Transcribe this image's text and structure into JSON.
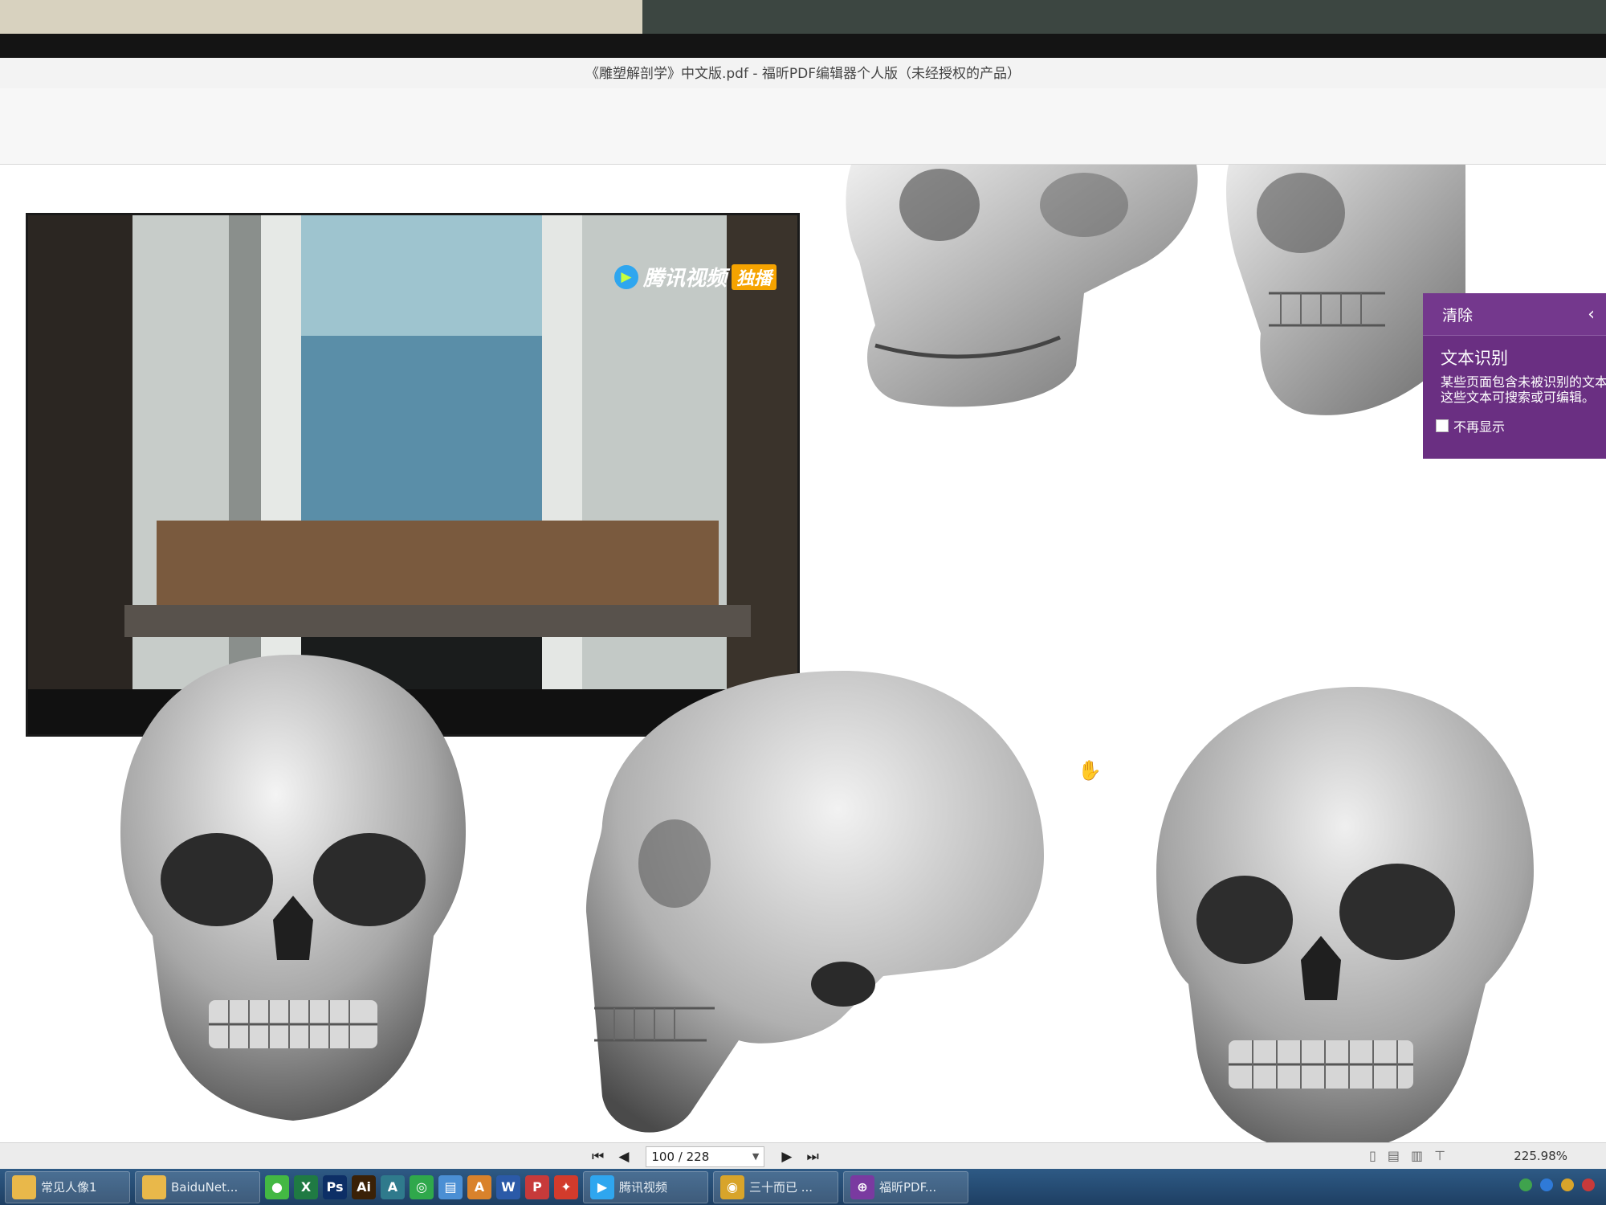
{
  "window": {
    "title": "《雕塑解剖学》中文版.pdf - 福昕PDF编辑器个人版（未经授权的产品）"
  },
  "video_overlay": {
    "brand": "腾讯视频",
    "badge": "独播"
  },
  "ocr_panel": {
    "clear_label": "清除",
    "collapse_icon": "chevron-left-icon",
    "title": "文本识别",
    "description": "某些页面包含未被识别的文本\n这些文本可搜索或可编辑。",
    "checkbox_label": "不再显示",
    "color": "#6a2f82"
  },
  "navigation": {
    "page_value": "100 / 228",
    "zoom": "225.98%",
    "first_icon": "skip-first-icon",
    "prev_icon": "prev-page-icon",
    "next_icon": "next-page-icon",
    "last_icon": "skip-last-icon"
  },
  "taskbar": {
    "items": [
      {
        "label": "常见人像1",
        "icon": "folder-icon",
        "color": "#e9b84a",
        "glyph": "",
        "button": true
      },
      {
        "label": "BaiduNet...",
        "icon": "folder-icon",
        "color": "#e9b84a",
        "glyph": "",
        "button": true
      },
      {
        "label": "",
        "icon": "wechat-icon",
        "color": "#43b843",
        "glyph": "●",
        "button": false
      },
      {
        "label": "",
        "icon": "excel-icon",
        "color": "#1f7a43",
        "glyph": "X",
        "button": false
      },
      {
        "label": "",
        "icon": "photoshop-icon",
        "color": "#0d2f66",
        "glyph": "Ps",
        "button": false
      },
      {
        "label": "",
        "icon": "illustrator-icon",
        "color": "#3a2107",
        "glyph": "Ai",
        "button": false
      },
      {
        "label": "",
        "icon": "autocad-icon",
        "color": "#2f7a8c",
        "glyph": "A",
        "button": false
      },
      {
        "label": "",
        "icon": "green-app-icon",
        "color": "#2fa84b",
        "glyph": "◎",
        "button": false
      },
      {
        "label": "",
        "icon": "folder-blue-icon",
        "color": "#4b8fd4",
        "glyph": "▤",
        "button": false
      },
      {
        "label": "",
        "icon": "orange-a-icon",
        "color": "#d9822b",
        "glyph": "A",
        "button": false
      },
      {
        "label": "",
        "icon": "word-icon",
        "color": "#2b5aa8",
        "glyph": "W",
        "button": false
      },
      {
        "label": "",
        "icon": "red-p-icon",
        "color": "#c73a3a",
        "glyph": "P",
        "button": false
      },
      {
        "label": "",
        "icon": "foxit-icon",
        "color": "#d23b2c",
        "glyph": "✦",
        "button": false
      },
      {
        "label": "腾讯视频",
        "icon": "tencent-video-icon",
        "color": "#2fa6ef",
        "glyph": "▶",
        "button": true
      },
      {
        "label": "三十而已 ...",
        "icon": "chrome-icon",
        "color": "#d8a42a",
        "glyph": "◉",
        "button": true
      },
      {
        "label": "福昕PDF...",
        "icon": "pdf-editor-icon",
        "color": "#7a3aa0",
        "glyph": "⊕",
        "button": true
      }
    ]
  }
}
